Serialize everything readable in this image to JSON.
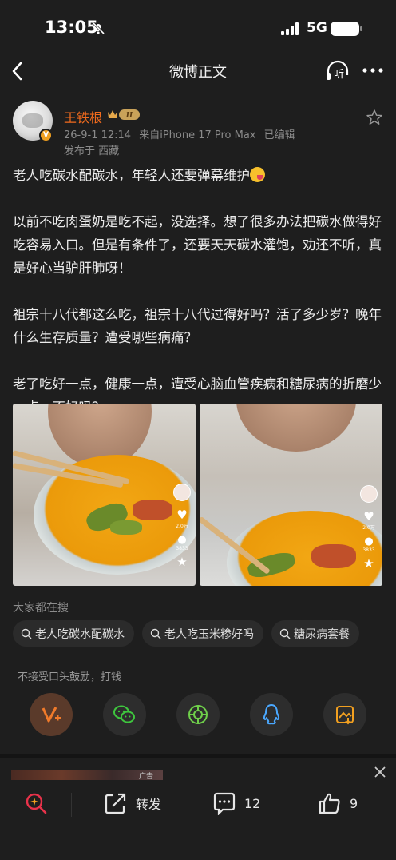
{
  "status": {
    "time": "13:05",
    "network": "5G"
  },
  "nav": {
    "title": "微博正文",
    "listen": "听"
  },
  "author": {
    "name": "王铁根",
    "level": "II",
    "verified": "V",
    "date": "26-9-1 12:14",
    "source": "来自iPhone 17 Pro Max",
    "edited": "已编辑",
    "location": "发布于 西藏"
  },
  "post": {
    "paragraphs": [
      "老人吃碳水配碳水，年轻人还要弹幕维护",
      "以前不吃肉蛋奶是吃不起，没选择。想了很多办法把碳水做得好吃容易入口。但是有条件了，还要天天碳水灌饱，劝还不听，真是好心当驴肝肺呀！",
      "祖宗十八代都这么吃，祖宗十八代过得好吗？活了多少岁？晚年什么生存质量？遭受哪些病痛？",
      "老了吃好一点，健康一点，遭受心脑血管疾病和糖尿病的折磨少一点，不好吗？"
    ]
  },
  "photos": [
    {
      "likes": "2.0万",
      "comments": "3833"
    },
    {
      "likes": "2.0万",
      "comments": "3833"
    }
  ],
  "hot_search": {
    "title": "大家都在搜",
    "chips": [
      "老人吃碳水配碳水",
      "老人吃玉米糁好吗",
      "糖尿病套餐"
    ]
  },
  "reward": {
    "text": "不接受口头鼓励，打钱"
  },
  "share_icons": [
    "vplus-icon",
    "wechat-icon",
    "moments-icon",
    "qq-icon",
    "save-image-icon"
  ],
  "ad": {
    "label": "广告"
  },
  "toolbar": {
    "repost_label": "转发",
    "comment_count": "12",
    "like_count": "9"
  },
  "colors": {
    "accent": "#f26b1d",
    "background": "#1e1e1e",
    "chip": "#2b2b2b"
  }
}
